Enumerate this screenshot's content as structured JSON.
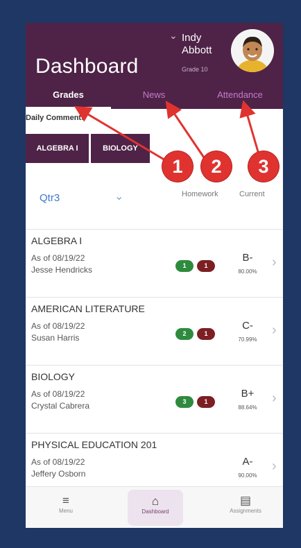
{
  "header": {
    "title": "Dashboard",
    "user_name": "Indy Abbott",
    "user_grade": "Grade 10",
    "user_chevron": "chevron-down-icon"
  },
  "tabs": [
    {
      "label": "Grades",
      "active": true
    },
    {
      "label": "News",
      "active": false
    },
    {
      "label": "Attendance",
      "active": false
    }
  ],
  "daily_comments": "Daily Comments",
  "chips": [
    {
      "label": "ALGEBRA I"
    },
    {
      "label": "BIOLOGY"
    }
  ],
  "filters": {
    "quarter": "Qtr3",
    "homework_header": "Homework",
    "current_header": "Current"
  },
  "courses": [
    {
      "name": "ALGEBRA I",
      "as_of": "As of 08/19/22",
      "teacher": "Jesse Hendricks",
      "green_count": "1",
      "red_count": "1",
      "letter": "B-",
      "percent": "80.00%"
    },
    {
      "name": "AMERICAN LITERATURE",
      "as_of": "As of 08/19/22",
      "teacher": "Susan Harris",
      "green_count": "2",
      "red_count": "1",
      "letter": "C-",
      "percent": "70.99%"
    },
    {
      "name": "BIOLOGY",
      "as_of": "As of 08/19/22",
      "teacher": "Crystal Cabrera",
      "green_count": "3",
      "red_count": "1",
      "letter": "B+",
      "percent": "88.64%"
    },
    {
      "name": "PHYSICAL EDUCATION 201",
      "as_of": "As of 08/19/22",
      "teacher": "Jeffery Osborn",
      "green_count": "",
      "red_count": "",
      "letter": "A-",
      "percent": "90.00%"
    }
  ],
  "bottom_nav": [
    {
      "label": "Menu",
      "icon": "menu-icon"
    },
    {
      "label": "Dashboard",
      "icon": "home-icon",
      "active": true
    },
    {
      "label": "Assignments",
      "icon": "assignments-icon"
    }
  ],
  "callouts": [
    "1",
    "2",
    "3"
  ],
  "colors": {
    "brand_purple": "#4e2347",
    "background_navy": "#1e3764",
    "callout_red": "#e03330",
    "tab_inactive": "#c77acb",
    "pill_green": "#2e8b3e",
    "pill_red": "#7c1f23"
  }
}
